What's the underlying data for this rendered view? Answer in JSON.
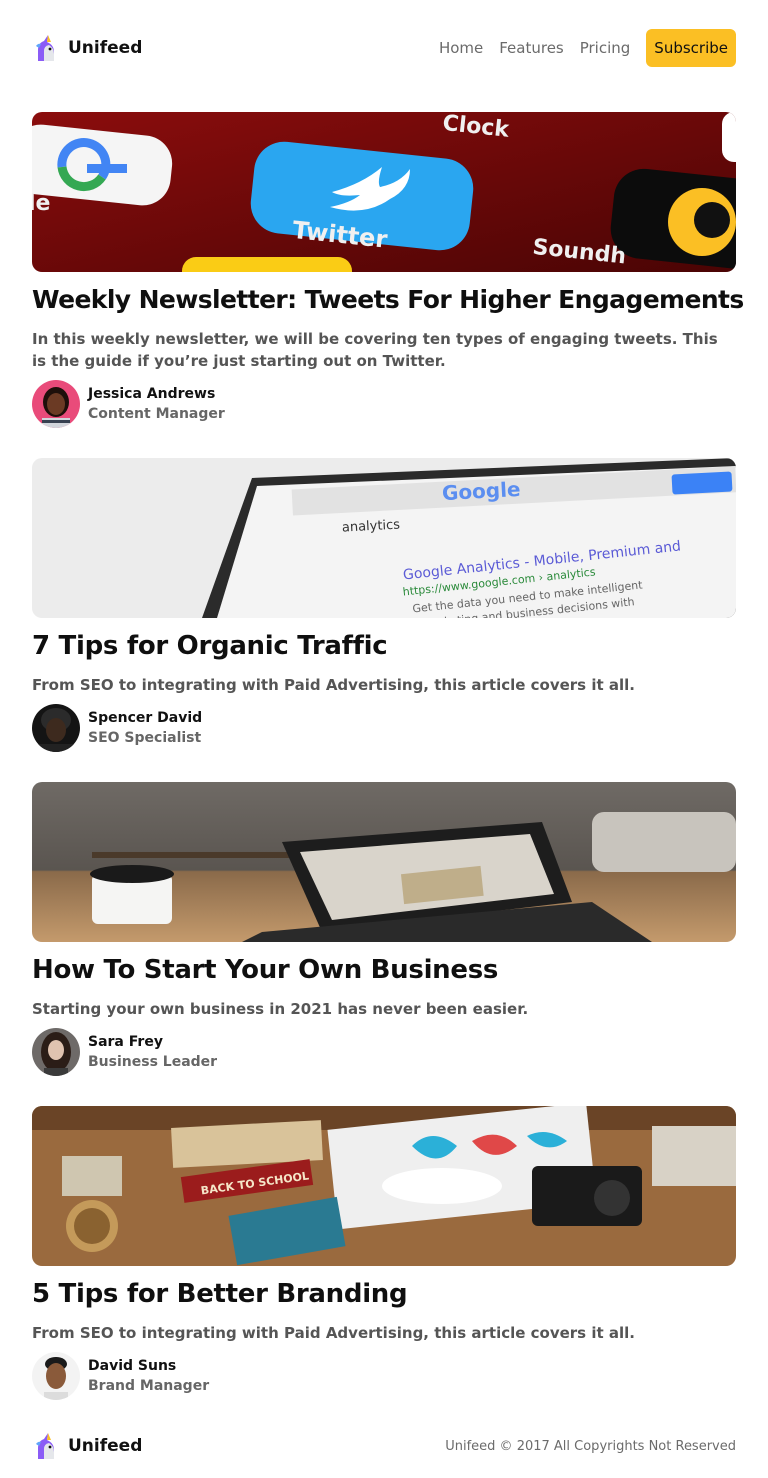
{
  "brand": {
    "name": "Unifeed",
    "logo_icon": "unicorn-icon"
  },
  "nav": {
    "links": [
      "Home",
      "Features",
      "Pricing"
    ],
    "subscribe_label": "Subscribe"
  },
  "posts": [
    {
      "title": "Weekly Newsletter: Tweets For Higher Engagements",
      "description": "In this weekly newsletter, we will be covering ten types of engaging tweets. This is the guide if you’re just starting out on Twitter.",
      "author_name": "Jessica Andrews",
      "author_role": "Content Manager"
    },
    {
      "title": "7 Tips for Organic Traffic",
      "description": "From SEO to integrating with Paid Advertising, this article covers it all.",
      "author_name": "Spencer David",
      "author_role": "SEO Specialist"
    },
    {
      "title": "How To Start Your Own Business",
      "description": "Starting your own business in 2021 has never been easier.",
      "author_name": "Sara Frey",
      "author_role": "Business Leader"
    },
    {
      "title": "5 Tips for Better Branding",
      "description": "From SEO to integrating with Paid Advertising, this article covers it all.",
      "author_name": "David Suns",
      "author_role": "Brand Manager"
    }
  ],
  "footer": {
    "brand_name": "Unifeed",
    "copyright": "Unifeed © 2017 All Copyrights Not Reserved"
  },
  "colors": {
    "accent": "#fbbf24",
    "text": "#111111",
    "muted": "#6b6b6b"
  }
}
